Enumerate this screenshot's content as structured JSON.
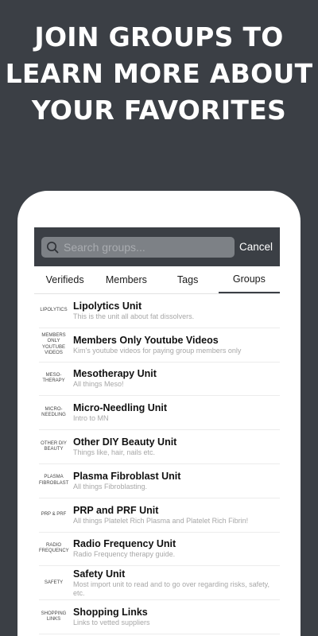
{
  "headline": {
    "line1": "JOIN GROUPS TO",
    "line2": "LEARN MORE ABOUT",
    "line3": "YOUR FAVORITES"
  },
  "search": {
    "placeholder": "Search groups...",
    "cancel_label": "Cancel"
  },
  "tabs": [
    {
      "label": "Verifieds"
    },
    {
      "label": "Members"
    },
    {
      "label": "Tags"
    },
    {
      "label": "Groups",
      "active": true
    }
  ],
  "groups": [
    {
      "icon_text": "LIPOLYTICS",
      "title": "Lipolytics Unit",
      "description": "This is the unit all about fat dissolvers."
    },
    {
      "icon_text": "MEMBERS ONLY YOUTUBE VIDEOS",
      "title": "Members Only Youtube Videos",
      "description": "Kim's youtube videos for paying group members only"
    },
    {
      "icon_text": "MESO-THERAPY",
      "title": "Mesotherapy Unit",
      "description": "All things Meso!"
    },
    {
      "icon_text": "MICRO-NEEDLING",
      "title": "Micro-Needling Unit",
      "description": "Intro to MN"
    },
    {
      "icon_text": "OTHER DIY BEAUTY",
      "title": "Other DIY Beauty Unit",
      "description": "Things like, hair, nails etc."
    },
    {
      "icon_text": "PLASMA FIBROBLAST",
      "title": "Plasma Fibroblast Unit",
      "description": "All things Fibroblasting."
    },
    {
      "icon_text": "PRP & PRF",
      "title": "PRP and PRF Unit",
      "description": "All things Platelet Rich Plasma and Platelet Rich Fibrin!"
    },
    {
      "icon_text": "RADIO FREQUENCY",
      "title": "Radio Frequency Unit",
      "description": "Radio Frequency therapy guide."
    },
    {
      "icon_text": "SAFETY",
      "title": "Safety Unit",
      "description": "Most import unit to read and to go over regarding risks, safety, etc."
    },
    {
      "icon_text": "SHOPPING LINKS",
      "title": "Shopping Links",
      "description": "Links to vetted suppliers"
    }
  ],
  "colors": {
    "background": "#3b3f45",
    "search_field": "#7d8186",
    "text_primary": "#111111",
    "text_secondary": "#a7a7a7"
  },
  "icons": {
    "search": "magnifier-icon"
  }
}
